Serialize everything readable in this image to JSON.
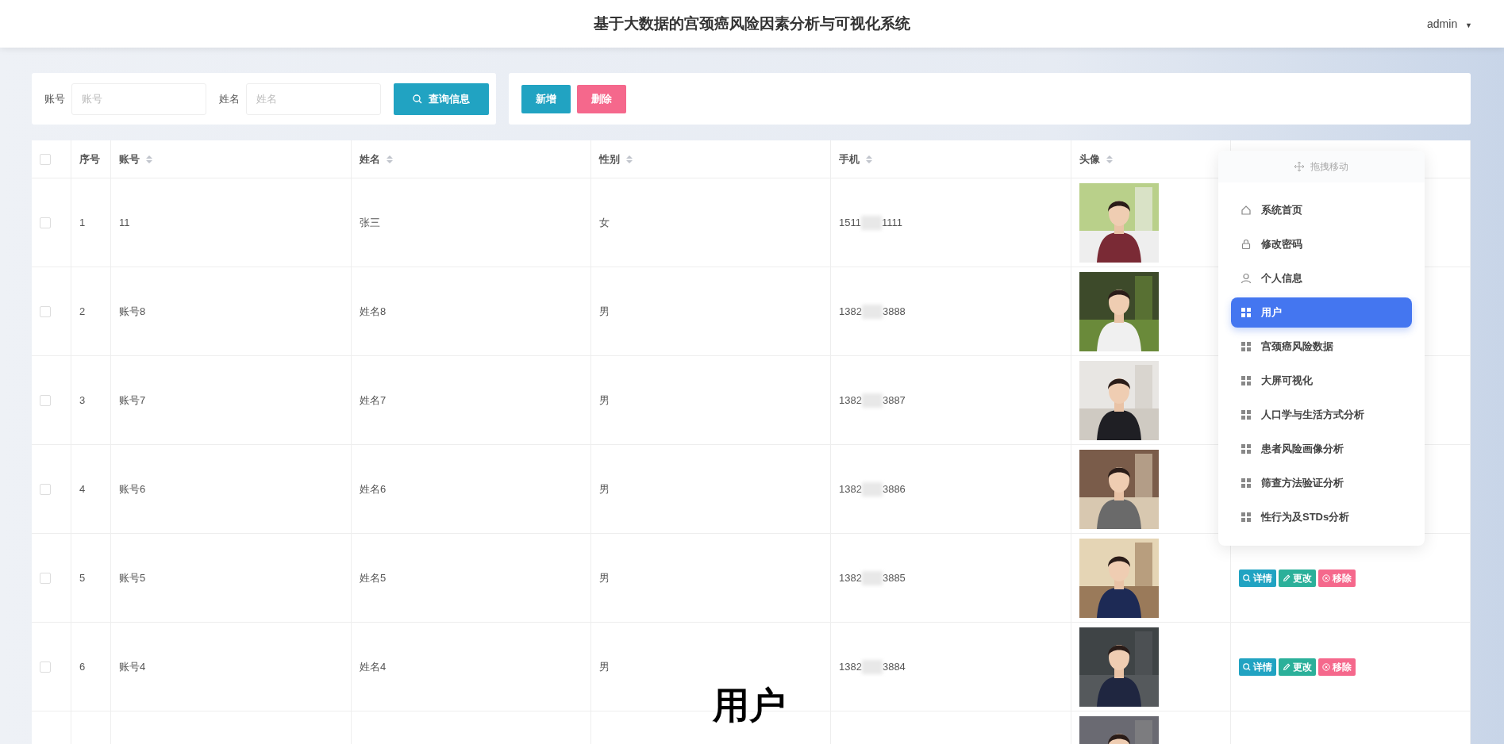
{
  "header": {
    "title": "基于大数据的宫颈癌风险因素分析与可视化系统",
    "user": "admin",
    "caret": "▼"
  },
  "search": {
    "fields": [
      {
        "label": "账号",
        "placeholder": "账号"
      },
      {
        "label": "姓名",
        "placeholder": "姓名"
      }
    ],
    "button": "查询信息"
  },
  "toolbar": {
    "buttons": [
      {
        "label": "新增",
        "kind": "add"
      },
      {
        "label": "删除",
        "kind": "delete"
      }
    ]
  },
  "table": {
    "select_all": {
      "checked": false
    },
    "columns": [
      {
        "label": "序号",
        "sortable": false
      },
      {
        "label": "账号",
        "sortable": true
      },
      {
        "label": "姓名",
        "sortable": true
      },
      {
        "label": "性别",
        "sortable": true
      },
      {
        "label": "手机",
        "sortable": true
      },
      {
        "label": "头像",
        "sortable": true
      }
    ],
    "rows": [
      {
        "checked": false,
        "index": "1",
        "account": "11",
        "name": "张三",
        "gender": "女",
        "phone_parts": [
          "1511",
          "1111"
        ],
        "actions": []
      },
      {
        "checked": false,
        "index": "2",
        "account": "账号8",
        "name": "姓名8",
        "gender": "男",
        "phone_parts": [
          "1382",
          "3888"
        ],
        "actions": []
      },
      {
        "checked": false,
        "index": "3",
        "account": "账号7",
        "name": "姓名7",
        "gender": "男",
        "phone_parts": [
          "1382",
          "3887"
        ],
        "actions": []
      },
      {
        "checked": false,
        "index": "4",
        "account": "账号6",
        "name": "姓名6",
        "gender": "男",
        "phone_parts": [
          "1382",
          "3886"
        ],
        "actions": []
      },
      {
        "checked": false,
        "index": "5",
        "account": "账号5",
        "name": "姓名5",
        "gender": "男",
        "phone_parts": [
          "1382",
          "3885"
        ],
        "actions": [
          {
            "label": "详情",
            "kind": "view"
          },
          {
            "label": "更改",
            "kind": "edit"
          },
          {
            "label": "移除",
            "kind": "remove"
          }
        ]
      },
      {
        "checked": false,
        "index": "6",
        "account": "账号4",
        "name": "姓名4",
        "gender": "男",
        "phone_parts": [
          "1382",
          "3884"
        ],
        "actions": [
          {
            "label": "详情",
            "kind": "view"
          },
          {
            "label": "更改",
            "kind": "edit"
          },
          {
            "label": "移除",
            "kind": "remove"
          }
        ]
      },
      {
        "kind": "partial"
      }
    ]
  },
  "float_menu": {
    "handle": "拖拽移动",
    "items": [
      {
        "label": "系统首页",
        "kind": "home",
        "selected": false
      },
      {
        "label": "修改密码",
        "kind": "lock",
        "selected": false
      },
      {
        "label": "个人信息",
        "kind": "user",
        "selected": false
      },
      {
        "label": "用户",
        "kind": "module",
        "selected": true
      },
      {
        "label": "宫颈癌风险数据",
        "kind": "module",
        "selected": false
      },
      {
        "label": "大屏可视化",
        "kind": "module",
        "selected": false
      },
      {
        "label": "人口学与生活方式分析",
        "kind": "module",
        "selected": false
      },
      {
        "label": "患者风险画像分析",
        "kind": "module",
        "selected": false
      },
      {
        "label": "筛查方法验证分析",
        "kind": "module",
        "selected": false
      },
      {
        "label": "性行为及STDs分析",
        "kind": "module",
        "selected": false
      }
    ]
  },
  "caption": "用户"
}
